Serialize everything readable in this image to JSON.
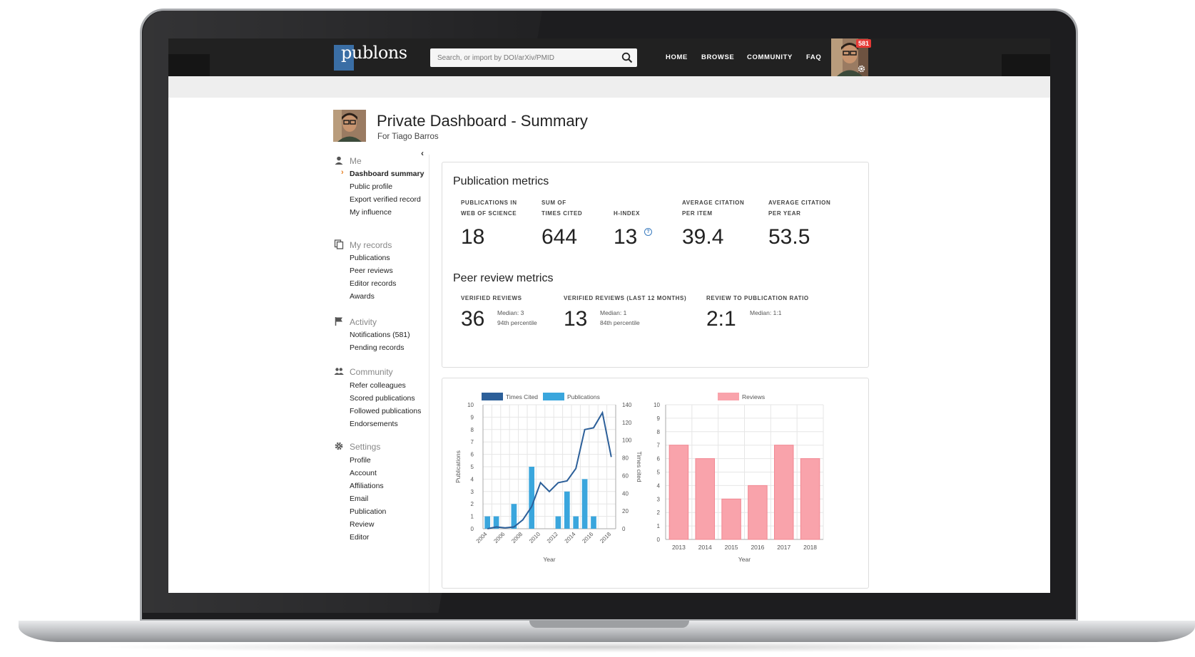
{
  "nav": {
    "logo": "publons",
    "search_placeholder": "Search, or import by DOI/arXiv/PMID",
    "links": [
      "HOME",
      "BROWSE",
      "COMMUNITY",
      "FAQ"
    ],
    "notification_count": "581"
  },
  "header": {
    "title": "Private Dashboard - Summary",
    "subtitle": "For Tiago Barros"
  },
  "sidebar": {
    "collapse": "‹",
    "sections": [
      {
        "title": "Me",
        "icon": "person-icon",
        "items": [
          "Dashboard summary",
          "Public profile",
          "Export verified record",
          "My influence"
        ]
      },
      {
        "title": "My records",
        "icon": "copy-icon",
        "items": [
          "Publications",
          "Peer reviews",
          "Editor records",
          "Awards"
        ]
      },
      {
        "title": "Activity",
        "icon": "flag-icon",
        "items": [
          "Notifications (581)",
          "Pending records"
        ]
      },
      {
        "title": "Community",
        "icon": "people-icon",
        "items": [
          "Refer colleagues",
          "Scored publications",
          "Followed publications",
          "Endorsements"
        ]
      },
      {
        "title": "Settings",
        "icon": "gear-icon",
        "items": [
          "Profile",
          "Account",
          "Affiliations",
          "Email",
          "Publication",
          "Review",
          "Editor"
        ]
      }
    ],
    "active_item": "Dashboard summary"
  },
  "publication_metrics": {
    "title": "Publication metrics",
    "items": [
      {
        "label1": "PUBLICATIONS IN",
        "label2": "WEB OF SCIENCE",
        "value": "18"
      },
      {
        "label1": "SUM OF",
        "label2": "TIMES CITED",
        "value": "644"
      },
      {
        "label1": "",
        "label2": "H-INDEX",
        "value": "13"
      },
      {
        "label1": "AVERAGE CITATION",
        "label2": "PER ITEM",
        "value": "39.4"
      },
      {
        "label1": "AVERAGE CITATION",
        "label2": "PER YEAR",
        "value": "53.5"
      }
    ]
  },
  "peer_review_metrics": {
    "title": "Peer review metrics",
    "items": [
      {
        "label": "VERIFIED REVIEWS",
        "value": "36",
        "median": "Median: 3",
        "percentile": "94th percentile"
      },
      {
        "label": "VERIFIED REVIEWS (LAST 12 MONTHS)",
        "value": "13",
        "median": "Median: 1",
        "percentile": "84th percentile"
      },
      {
        "label": "REVIEW TO PUBLICATION RATIO",
        "value": "2:1",
        "median": "Median: 1:1",
        "percentile": ""
      }
    ]
  },
  "colors": {
    "times_cited": "#2c5f99",
    "publications": "#3aa6dd",
    "reviews": "#f9a3ab",
    "accent": "#e67e22"
  },
  "chart_data": [
    {
      "type": "bar",
      "x": [
        2004,
        2005,
        2006,
        2007,
        2008,
        2009,
        2010,
        2011,
        2012,
        2013,
        2014,
        2015,
        2016,
        2017,
        2018
      ],
      "x_tick_labels": [
        "2004",
        "2006",
        "2008",
        "2010",
        "2012",
        "2014",
        "2016",
        "2018"
      ],
      "series": [
        {
          "name": "Times Cited",
          "type": "line",
          "axis": "right",
          "values": [
            0,
            2,
            1,
            2,
            10,
            25,
            52,
            42,
            52,
            54,
            68,
            112,
            114,
            131,
            81
          ]
        },
        {
          "name": "Publications",
          "type": "bar",
          "axis": "left",
          "values": [
            1,
            1,
            0,
            2,
            0,
            5,
            0,
            0,
            1,
            3,
            1,
            4,
            1,
            0,
            0
          ]
        }
      ],
      "xlabel": "Year",
      "ylabel_left": "Publications",
      "ylabel_right": "Times cited",
      "ylim_left": [
        0,
        10
      ],
      "ylim_right": [
        0,
        140
      ],
      "yticks_left": [
        "0",
        "1",
        "2",
        "3",
        "4",
        "5",
        "6",
        "7",
        "8",
        "9",
        "10"
      ],
      "yticks_right": [
        "0",
        "20",
        "40",
        "60",
        "80",
        "100",
        "120",
        "140"
      ],
      "grid": true,
      "legend": "top"
    },
    {
      "type": "bar",
      "categories": [
        "2013",
        "2014",
        "2015",
        "2016",
        "2017",
        "2018"
      ],
      "series": [
        {
          "name": "Reviews",
          "values": [
            7,
            6,
            3,
            4,
            7,
            6
          ]
        }
      ],
      "xlabel": "Year",
      "ylim": [
        0,
        10
      ],
      "yticks": [
        "0",
        "1",
        "2",
        "3",
        "4",
        "5",
        "6",
        "7",
        "8",
        "9",
        "10"
      ],
      "grid": true,
      "legend": "top"
    }
  ]
}
